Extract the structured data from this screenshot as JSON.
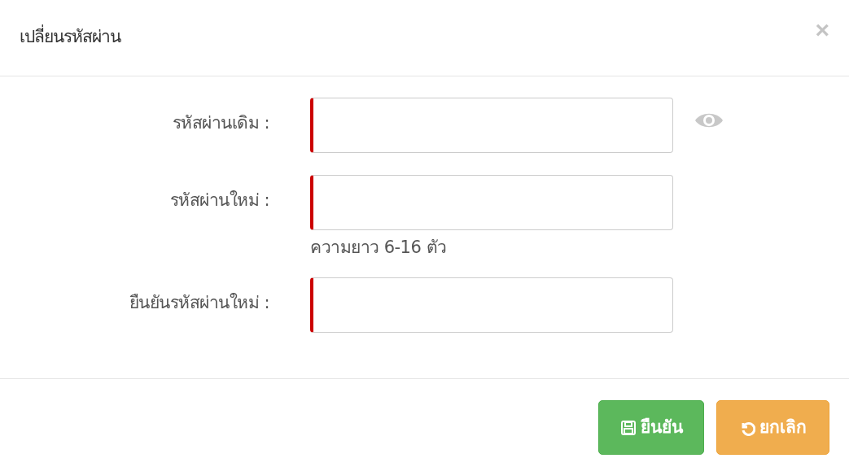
{
  "dialog": {
    "title": "เปลี่ยนรหัสผ่าน",
    "close": "×"
  },
  "fields": [
    {
      "label": "รหัสผ่านเดิม :",
      "required": true,
      "show_toggle": true
    },
    {
      "label": "รหัสผ่านใหม่ :",
      "required": true,
      "show_toggle": false,
      "hint": "ความยาว 6-16 ตัว"
    },
    {
      "label": "ยืนยันรหัสผ่านใหม่ :",
      "required": true,
      "show_toggle": false
    }
  ],
  "buttons": [
    {
      "kind": "save",
      "label": "ยืนยัน"
    },
    {
      "kind": "cancel",
      "label": "ยกเลิก"
    }
  ]
}
